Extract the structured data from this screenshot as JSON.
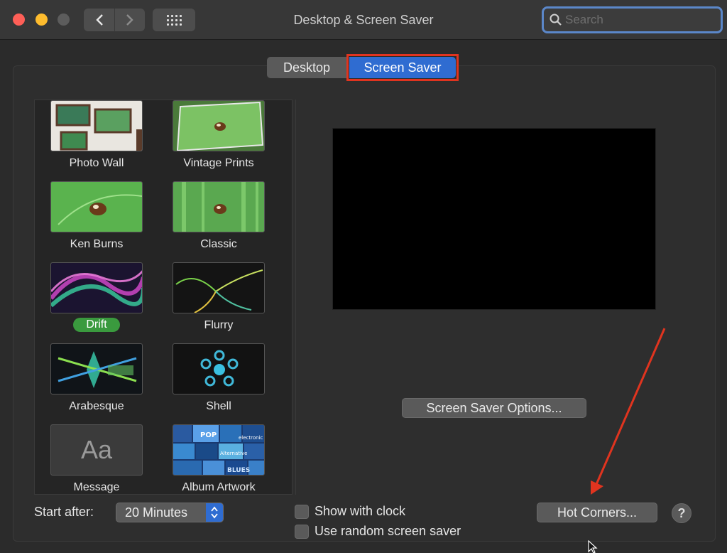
{
  "window": {
    "title": "Desktop & Screen Saver",
    "search_placeholder": "Search"
  },
  "tabs": [
    {
      "label": "Desktop",
      "selected": false
    },
    {
      "label": "Screen Saver",
      "selected": true
    }
  ],
  "savers": [
    {
      "label": "Photo Wall",
      "icon": "photo-wall-thumbnail"
    },
    {
      "label": "Vintage Prints",
      "icon": "vintage-prints-thumbnail"
    },
    {
      "label": "Ken Burns",
      "icon": "ken-burns-thumbnail"
    },
    {
      "label": "Classic",
      "icon": "classic-thumbnail"
    },
    {
      "label": "Drift",
      "icon": "drift-thumbnail",
      "selected": true
    },
    {
      "label": "Flurry",
      "icon": "flurry-thumbnail"
    },
    {
      "label": "Arabesque",
      "icon": "arabesque-thumbnail"
    },
    {
      "label": "Shell",
      "icon": "shell-thumbnail"
    },
    {
      "label": "Message",
      "icon": "message-thumbnail",
      "thumb_text": "Aa"
    },
    {
      "label": "Album Artwork",
      "icon": "album-artwork-thumbnail"
    }
  ],
  "album_tiles": [
    "POP",
    "Alternative",
    "electronic",
    "BLUES"
  ],
  "buttons": {
    "options": "Screen Saver Options...",
    "hot_corners": "Hot Corners...",
    "help": "?"
  },
  "start_after": {
    "label": "Start after:",
    "value": "20 Minutes"
  },
  "checkboxes": {
    "show_clock": {
      "label": "Show with clock",
      "checked": false
    },
    "random": {
      "label": "Use random screen saver",
      "checked": false
    }
  },
  "colors": {
    "accent": "#2f6cd1",
    "selected_badge": "#3a9a3e",
    "annotation": "#e0341f"
  }
}
